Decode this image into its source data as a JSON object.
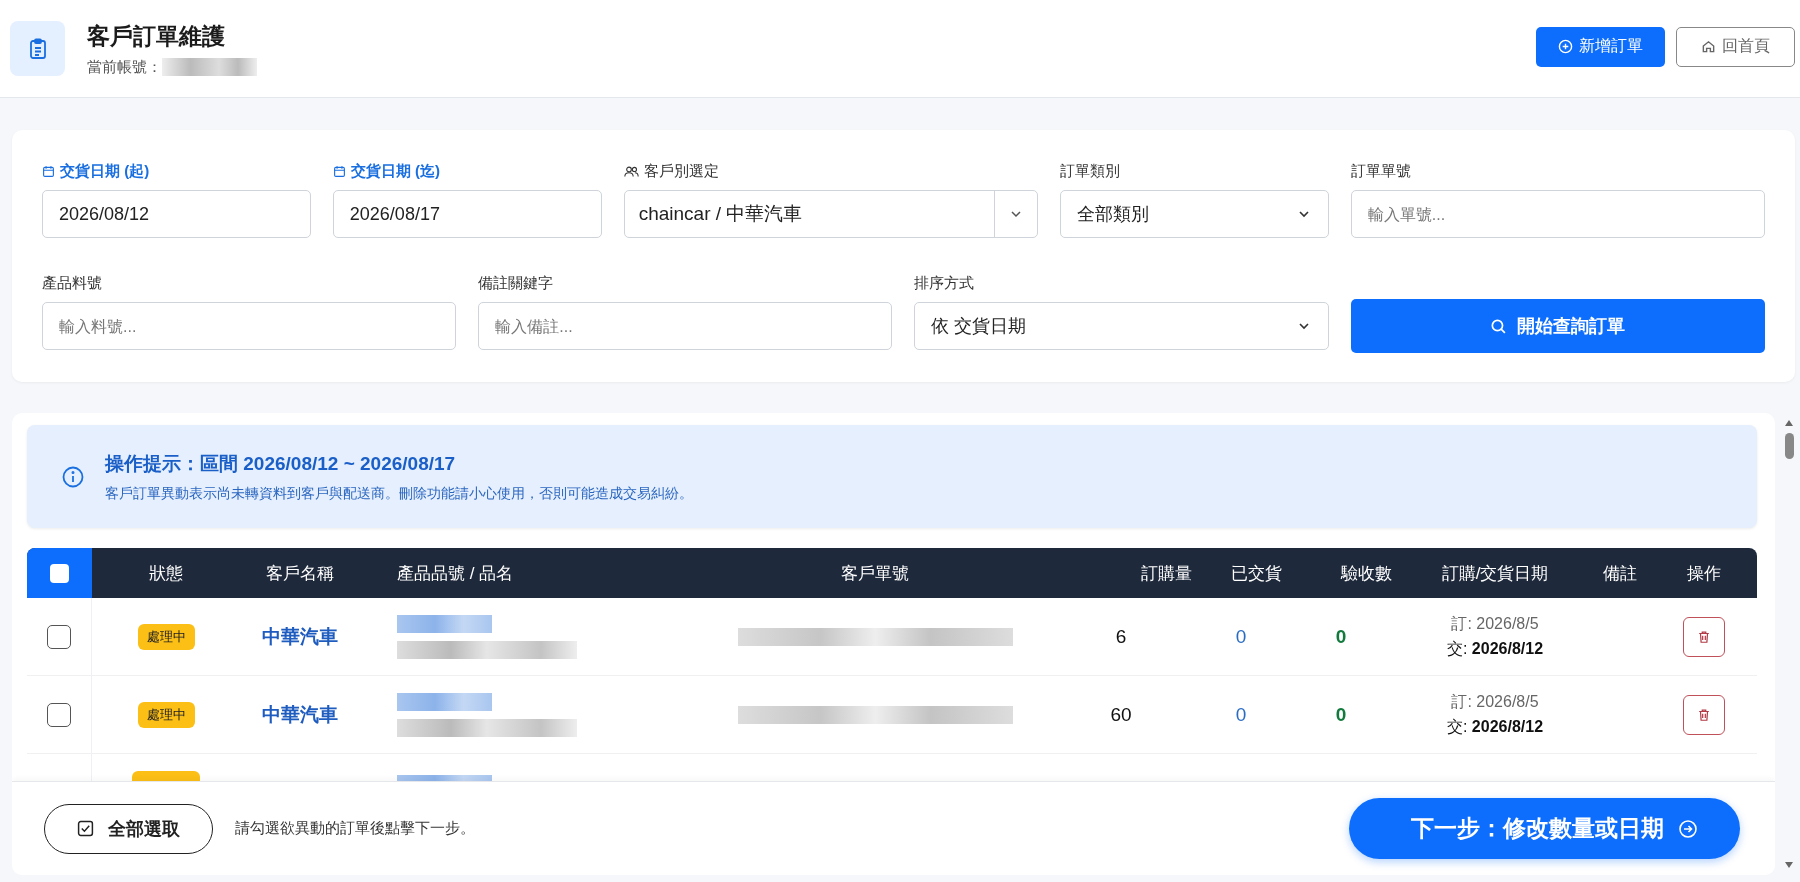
{
  "header": {
    "title": "客戶訂單維護",
    "account_label": "當前帳號："
  },
  "header_buttons": [
    {
      "kind": "primary",
      "label": "新增訂單"
    },
    {
      "kind": "outline",
      "label": "回首頁"
    }
  ],
  "filters": [
    {
      "kind": "date",
      "label": "交貨日期 (起)",
      "value": "2026/08/12"
    },
    {
      "kind": "date",
      "label": "交貨日期 (迄)",
      "value": "2026/08/17"
    },
    {
      "kind": "combo",
      "label": "客戶別選定",
      "value": "chaincar / 中華汽車"
    },
    {
      "kind": "select",
      "label": "訂單類別",
      "value": "全部類別"
    },
    {
      "kind": "text",
      "label": "訂單單號",
      "placeholder": "輸入單號..."
    },
    {
      "kind": "text",
      "label": "產品料號",
      "placeholder": "輸入料號..."
    },
    {
      "kind": "text",
      "label": "備註關鍵字",
      "placeholder": "輸入備註..."
    },
    {
      "kind": "select",
      "label": "排序方式",
      "value": "依 交貨日期"
    },
    {
      "kind": "button",
      "label": "開始查詢訂單"
    }
  ],
  "notice": {
    "title": "操作提示：區間 2026/08/12 ~ 2026/08/17",
    "text": "客戶訂單異動表示尚未轉資料到客戶與配送商。刪除功能請小心使用，否則可能造成交易糾紛。"
  },
  "table": {
    "select_all_checked": false,
    "columns": [
      "狀態",
      "客戶名稱",
      "產品品號 / 品名",
      "客戶單號",
      "訂購量",
      "已交貨",
      "驗收數",
      "訂購/交貨日期",
      "備註",
      "操作"
    ],
    "rows": [
      {
        "selected": false,
        "status": "處理中",
        "customer": "中華汽車",
        "qty": "6",
        "delivered": "0",
        "accepted": "0",
        "order_date": "訂: 2026/8/5",
        "delivery_date": "交: **2026/8/12**"
      },
      {
        "selected": false,
        "status": "處理中",
        "customer": "中華汽車",
        "qty": "60",
        "delivered": "0",
        "accepted": "0",
        "order_date": "訂: 2026/8/5",
        "delivery_date": "交: **2026/8/12**"
      }
    ]
  },
  "footer": {
    "select_all_button": "全部選取",
    "hint": "請勾選欲異動的訂單後點擊下一步。",
    "next_button": "下一步：修改數量或日期"
  }
}
